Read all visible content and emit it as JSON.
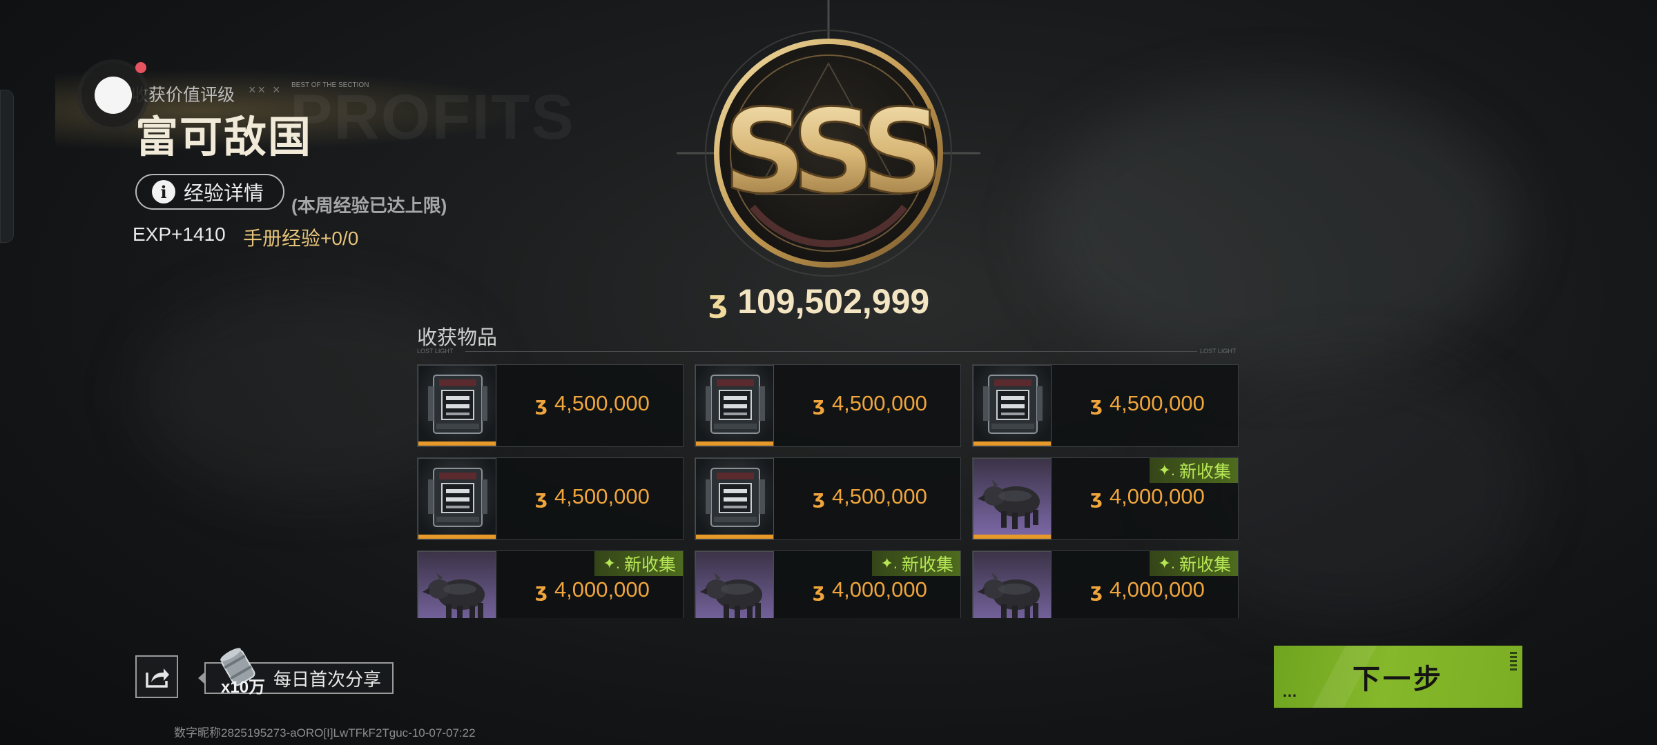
{
  "rating": {
    "label": "收获价值评级",
    "deco": "×× ×",
    "tiny": "BEST OF THE SECTION",
    "bg_word": "PROFITS",
    "title": "富可敌国",
    "grade": "SSS"
  },
  "exp": {
    "details_button": "经验详情",
    "cap_note": "(本周经验已达上限)",
    "gain": "EXP+1410",
    "handbook": "手册经验+0/0"
  },
  "total_value": "109,502,999",
  "items": {
    "header": "收获物品",
    "line_tag_left": "LOST LIGHT",
    "line_tag_right": "LOST LIGHT",
    "new_label": "新收集",
    "list": [
      {
        "type": "case",
        "value": "4,500,000",
        "new": false
      },
      {
        "type": "case",
        "value": "4,500,000",
        "new": false
      },
      {
        "type": "case",
        "value": "4,500,000",
        "new": false
      },
      {
        "type": "case",
        "value": "4,500,000",
        "new": false
      },
      {
        "type": "case",
        "value": "4,500,000",
        "new": false
      },
      {
        "type": "boar",
        "value": "4,000,000",
        "new": true
      },
      {
        "type": "boar",
        "value": "4,000,000",
        "new": true
      },
      {
        "type": "boar",
        "value": "4,000,000",
        "new": true
      },
      {
        "type": "boar",
        "value": "4,000,000",
        "new": true
      }
    ]
  },
  "share": {
    "reward_qty": "x10万",
    "label": "每日首次分享"
  },
  "next_button": "下一步",
  "footer_id": "数字昵称2825195273-aORO[I]LwTFkF2Tguc-10-07-07:22",
  "icons": {
    "coin": "coin-icon",
    "info": "info-icon",
    "share": "share-icon",
    "sparkle": "sparkle-icon"
  },
  "colors": {
    "value_orange": "#f0a53c",
    "new_green": "#b6e654",
    "next_green": "#7cae24",
    "gold": "#c9a45a"
  }
}
